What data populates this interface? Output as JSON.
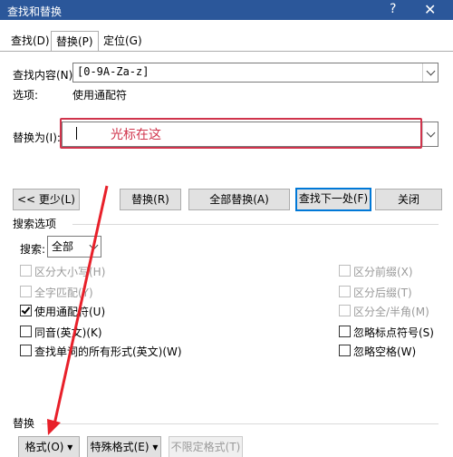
{
  "window": {
    "title": "查找和替换",
    "help": "?",
    "close": "✕"
  },
  "tabs": [
    {
      "label": "查找(D)"
    },
    {
      "label": "替换(P)"
    },
    {
      "label": "定位(G)"
    }
  ],
  "find": {
    "label": "查找内容(N):",
    "value": "[0-9A-Za-z]",
    "options_label": "选项:",
    "options_value": "使用通配符"
  },
  "replace": {
    "label": "替换为(I):",
    "value": "",
    "annotation": "光标在这"
  },
  "buttons": {
    "less": "<< 更少(L)",
    "replace": "替换(R)",
    "replace_all": "全部替换(A)",
    "find_next": "查找下一处(F)",
    "close": "关闭"
  },
  "search_options": {
    "title": "搜索选项",
    "search_label": "搜索:",
    "search_value": "全部",
    "left": [
      {
        "label": "区分大小写(H)",
        "checked": false,
        "enabled": false
      },
      {
        "label": "全字匹配(Y)",
        "checked": false,
        "enabled": false
      },
      {
        "label": "使用通配符(U)",
        "checked": true,
        "enabled": true
      },
      {
        "label": "同音(英文)(K)",
        "checked": false,
        "enabled": true
      },
      {
        "label": "查找单词的所有形式(英文)(W)",
        "checked": false,
        "enabled": true
      }
    ],
    "right": [
      {
        "label": "区分前缀(X)",
        "checked": false,
        "enabled": false
      },
      {
        "label": "区分后缀(T)",
        "checked": false,
        "enabled": false
      },
      {
        "label": "区分全/半角(M)",
        "checked": false,
        "enabled": false
      },
      {
        "label": "忽略标点符号(S)",
        "checked": false,
        "enabled": true
      },
      {
        "label": "忽略空格(W)",
        "checked": false,
        "enabled": true
      }
    ]
  },
  "replace_section": {
    "title": "替换",
    "format": "格式(O) ▾",
    "special": "特殊格式(E) ▾",
    "no_format": "不限定格式(T)"
  },
  "colors": {
    "titlebar": "#2b579a",
    "annotation": "#d0344c",
    "primary_border": "#0078d7"
  }
}
